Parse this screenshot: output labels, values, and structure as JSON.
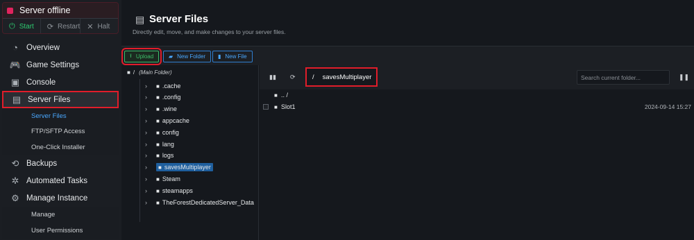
{
  "status": {
    "label": "Server offline",
    "color": "#e0245e"
  },
  "server_actions": [
    {
      "label": "Start",
      "icon": "power-icon"
    },
    {
      "label": "Restart",
      "icon": "restart-icon"
    },
    {
      "label": "Halt",
      "icon": "close-icon"
    }
  ],
  "nav": {
    "overview": "Overview",
    "game_settings": "Game Settings",
    "console": "Console",
    "server_files": "Server Files",
    "server_files_sub": [
      "Server Files",
      "FTP/SFTP Access",
      "One-Click Installer"
    ],
    "backups": "Backups",
    "automated_tasks": "Automated Tasks",
    "manage_instance": "Manage Instance",
    "manage_sub": [
      "Manage",
      "User Permissions"
    ]
  },
  "header": {
    "title": "Server Files",
    "subtitle": "Directly edit, move, and make changes to your server files."
  },
  "toolbar": {
    "upload": "Upload",
    "new_folder": "New Folder",
    "new_file": "New File"
  },
  "tree": {
    "root_slash": "/",
    "root_label": "(Main Folder)",
    "items": [
      ".cache",
      ".config",
      ".wine",
      "appcache",
      "config",
      "lang",
      "logs",
      "savesMultiplayer",
      "Steam",
      "steamapps",
      "TheForestDedicatedServer_Data"
    ],
    "selected": "savesMultiplayer"
  },
  "path": {
    "slash": "/",
    "folder": "savesMultiplayer"
  },
  "search": {
    "placeholder": "Search current folder..."
  },
  "files": {
    "parent": ".. /",
    "rows": [
      {
        "name": "Slot1",
        "date": "2024-09-14 15:27"
      }
    ]
  },
  "colors": {
    "accent": "#4aa8ff",
    "success": "#3dbf6a",
    "highlight": "#e11d2a"
  }
}
